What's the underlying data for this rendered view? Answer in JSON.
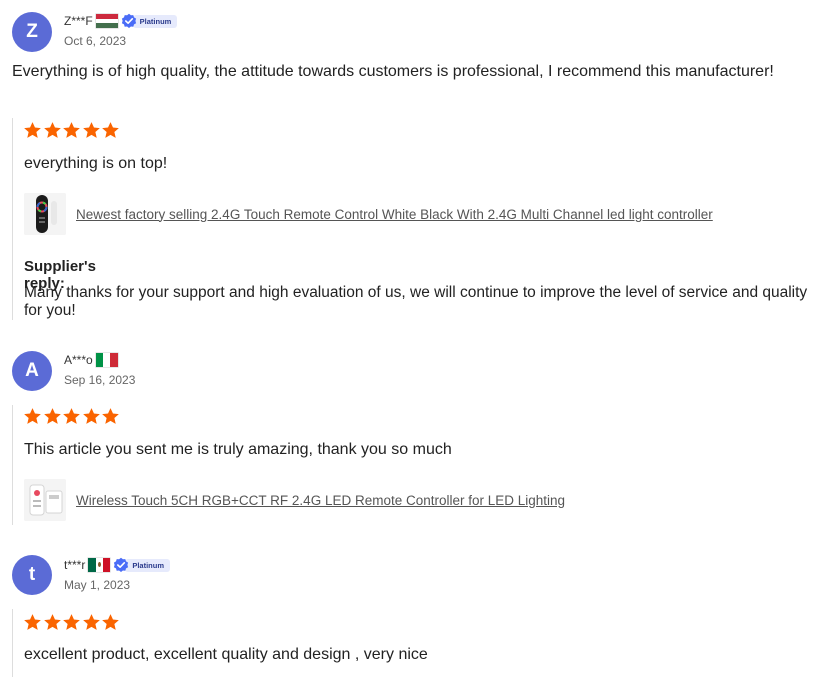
{
  "colors": {
    "avatar": "#5b6bd6",
    "star": "#fa6400",
    "badge_bg": "#e6eafc",
    "badge_check": "#4a6cf7"
  },
  "reviews": [
    {
      "avatar_letter": "Z",
      "user": "Z***F",
      "flag": "hungary-flag-icon",
      "badge": "Platinum",
      "date": "Oct 6, 2023",
      "comment": "Everything is of high quality, the attitude towards customers is professional, I recommend this manufacturer!",
      "rating": 5,
      "text": "everything is on top!",
      "product_link": "Newest factory selling 2.4G Touch Remote Control White Black With 2.4G Multi Channel led light controller",
      "reply_title": "Supplier's reply:",
      "reply_text": "Many thanks for your support and high evaluation of us, we will continue to improve the level of service and quality for you!"
    },
    {
      "avatar_letter": "A",
      "user": "A***o",
      "flag": "italy-flag-icon",
      "date": "Sep 16, 2023",
      "rating": 5,
      "text": "This article you sent me is truly amazing, thank you so much",
      "product_link": "Wireless Touch 5CH RGB+CCT RF 2.4G LED Remote Controller for LED Lighting"
    },
    {
      "avatar_letter": "t",
      "user": "t***r",
      "flag": "mexico-flag-icon",
      "badge": "Platinum",
      "date": "May 1, 2023",
      "rating": 5,
      "text": "excellent product, excellent quality and design , very nice"
    }
  ]
}
